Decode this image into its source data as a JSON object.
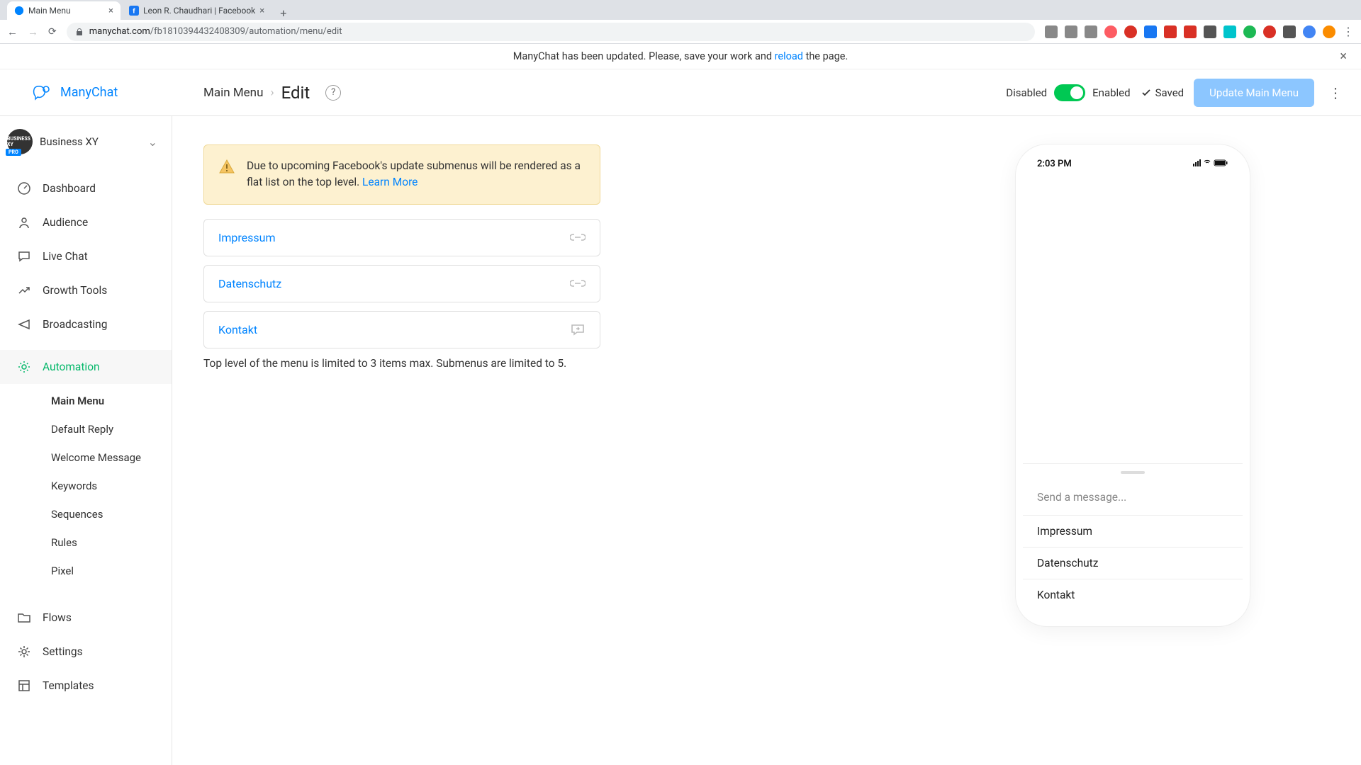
{
  "browser": {
    "tabs": [
      {
        "title": "Main Menu",
        "favicon": "manychat"
      },
      {
        "title": "Leon R. Chaudhari | Facebook",
        "favicon": "facebook"
      }
    ],
    "url_domain": "manychat.com",
    "url_path": "/fb181039443240830​9/automation/menu/edit"
  },
  "notification": {
    "prefix": "ManyChat has been updated. Please, save your work and ",
    "link": "reload",
    "suffix": " the page."
  },
  "logo": "ManyChat",
  "breadcrumb": {
    "parent": "Main Menu",
    "current": "Edit"
  },
  "header_controls": {
    "disabled_label": "Disabled",
    "enabled_label": "Enabled",
    "saved_label": "Saved",
    "update_button": "Update Main Menu"
  },
  "workspace": {
    "name": "Business XY",
    "badge": "PRO"
  },
  "sidebar": {
    "items": [
      {
        "label": "Dashboard",
        "icon": "dashboard"
      },
      {
        "label": "Audience",
        "icon": "audience"
      },
      {
        "label": "Live Chat",
        "icon": "chat"
      },
      {
        "label": "Growth Tools",
        "icon": "growth"
      },
      {
        "label": "Broadcasting",
        "icon": "broadcast"
      }
    ],
    "automation_label": "Automation",
    "automation_sub": [
      {
        "label": "Main Menu",
        "current": true
      },
      {
        "label": "Default Reply"
      },
      {
        "label": "Welcome Message"
      },
      {
        "label": "Keywords"
      },
      {
        "label": "Sequences"
      },
      {
        "label": "Rules"
      },
      {
        "label": "Pixel"
      }
    ],
    "items_after": [
      {
        "label": "Flows",
        "icon": "folder"
      },
      {
        "label": "Settings",
        "icon": "gear"
      },
      {
        "label": "Templates",
        "icon": "templates"
      }
    ]
  },
  "warning": {
    "text": "Due to upcoming Facebook's update submenus will be rendered as a flat list on the top level. ",
    "link": "Learn More"
  },
  "menu_items": [
    {
      "label": "Impressum",
      "type": "url"
    },
    {
      "label": "Datenschutz",
      "type": "url"
    },
    {
      "label": "Kontakt",
      "type": "reply"
    }
  ],
  "limit_text": "Top level of the menu is limited to 3 items max. Submenus are limited to 5.",
  "phone": {
    "time": "2:03 PM",
    "composer_placeholder": "Send a message..."
  }
}
